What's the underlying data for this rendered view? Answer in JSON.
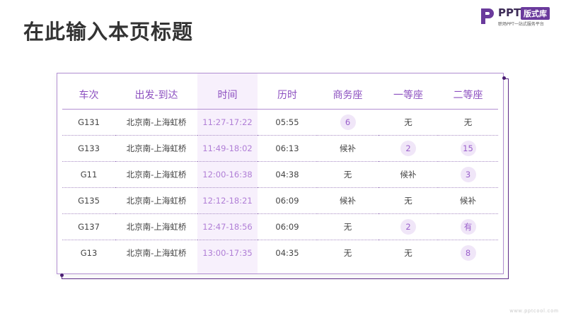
{
  "page_title": "在此输入本页标题",
  "logo": {
    "brand": "PPT",
    "badge": "版式库",
    "tagline": "职场PPT一站式服务平台"
  },
  "table": {
    "columns": [
      "车次",
      "出发-到达",
      "时间",
      "历时",
      "商务座",
      "一等座",
      "二等座"
    ],
    "rows": [
      {
        "train": "G131",
        "route": "北京南-上海虹桥",
        "time": "11:27-17:22",
        "duration": "05:55",
        "business": "6",
        "first": "无",
        "second": "无"
      },
      {
        "train": "G133",
        "route": "北京南-上海虹桥",
        "time": "11:49-18:02",
        "duration": "06:13",
        "business": "候补",
        "first": "2",
        "second": "15"
      },
      {
        "train": "G11",
        "route": "北京南-上海虹桥",
        "time": "12:00-16:38",
        "duration": "04:38",
        "business": "无",
        "first": "候补",
        "second": "3"
      },
      {
        "train": "G135",
        "route": "北京南-上海虹桥",
        "time": "12:12-18:21",
        "duration": "06:09",
        "business": "候补",
        "first": "无",
        "second": "候补"
      },
      {
        "train": "G137",
        "route": "北京南-上海虹桥",
        "time": "12:47-18:56",
        "duration": "06:09",
        "business": "无",
        "first": "2",
        "second": "有"
      },
      {
        "train": "G13",
        "route": "北京南-上海虹桥",
        "time": "13:00-17:35",
        "duration": "04:35",
        "business": "无",
        "first": "无",
        "second": "8"
      }
    ]
  },
  "watermark": "www.pptcool.com",
  "colors": {
    "accent": "#8c4fc0",
    "frame": "#5b2a86",
    "time_band": "#f7f0fc",
    "pill_bg": "#f0e6f8"
  },
  "icons": {
    "logo": "ppt-logo-mark-icon"
  }
}
